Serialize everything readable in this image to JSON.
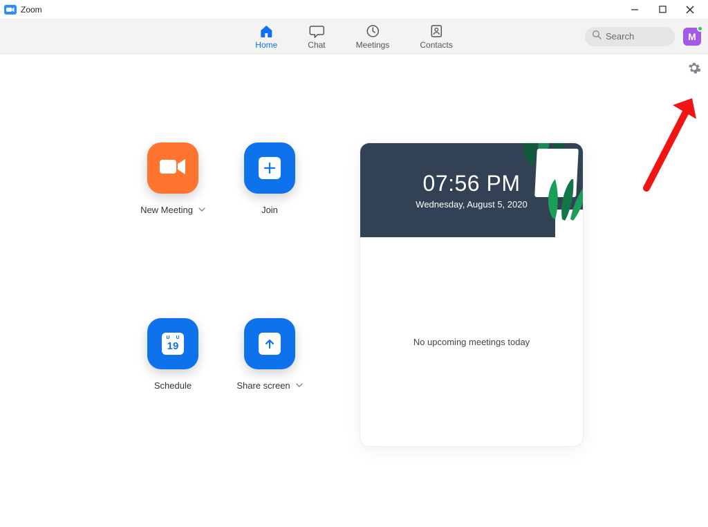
{
  "titlebar": {
    "app_name": "Zoom"
  },
  "nav": {
    "tabs": {
      "home": "Home",
      "chat": "Chat",
      "meetings": "Meetings",
      "contacts": "Contacts"
    },
    "search_placeholder": "Search",
    "avatar_initial": "M"
  },
  "actions": {
    "new_meeting": "New Meeting",
    "join": "Join",
    "schedule": "Schedule",
    "share_screen": "Share screen",
    "calendar_day": "19"
  },
  "panel": {
    "time": "07:56 PM",
    "date": "Wednesday, August 5, 2020",
    "empty_text": "No upcoming meetings today"
  }
}
